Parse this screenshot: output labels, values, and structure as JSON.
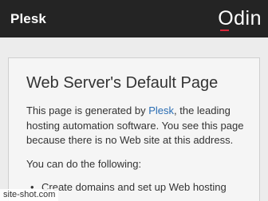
{
  "header": {
    "brand": "Plesk",
    "logo_text": "Odin",
    "logo_accent_color": "#d9283a"
  },
  "content": {
    "title": "Web Server's Default Page",
    "intro_before": "This page is generated by ",
    "intro_link": "Plesk",
    "intro_after": ", the leading hosting automation software. You see this page because there is no Web site at this address.",
    "action_prompt": "You can do the following:",
    "list_item_1": "Create domains and set up Web hosting"
  },
  "watermark": "site-shot.com"
}
